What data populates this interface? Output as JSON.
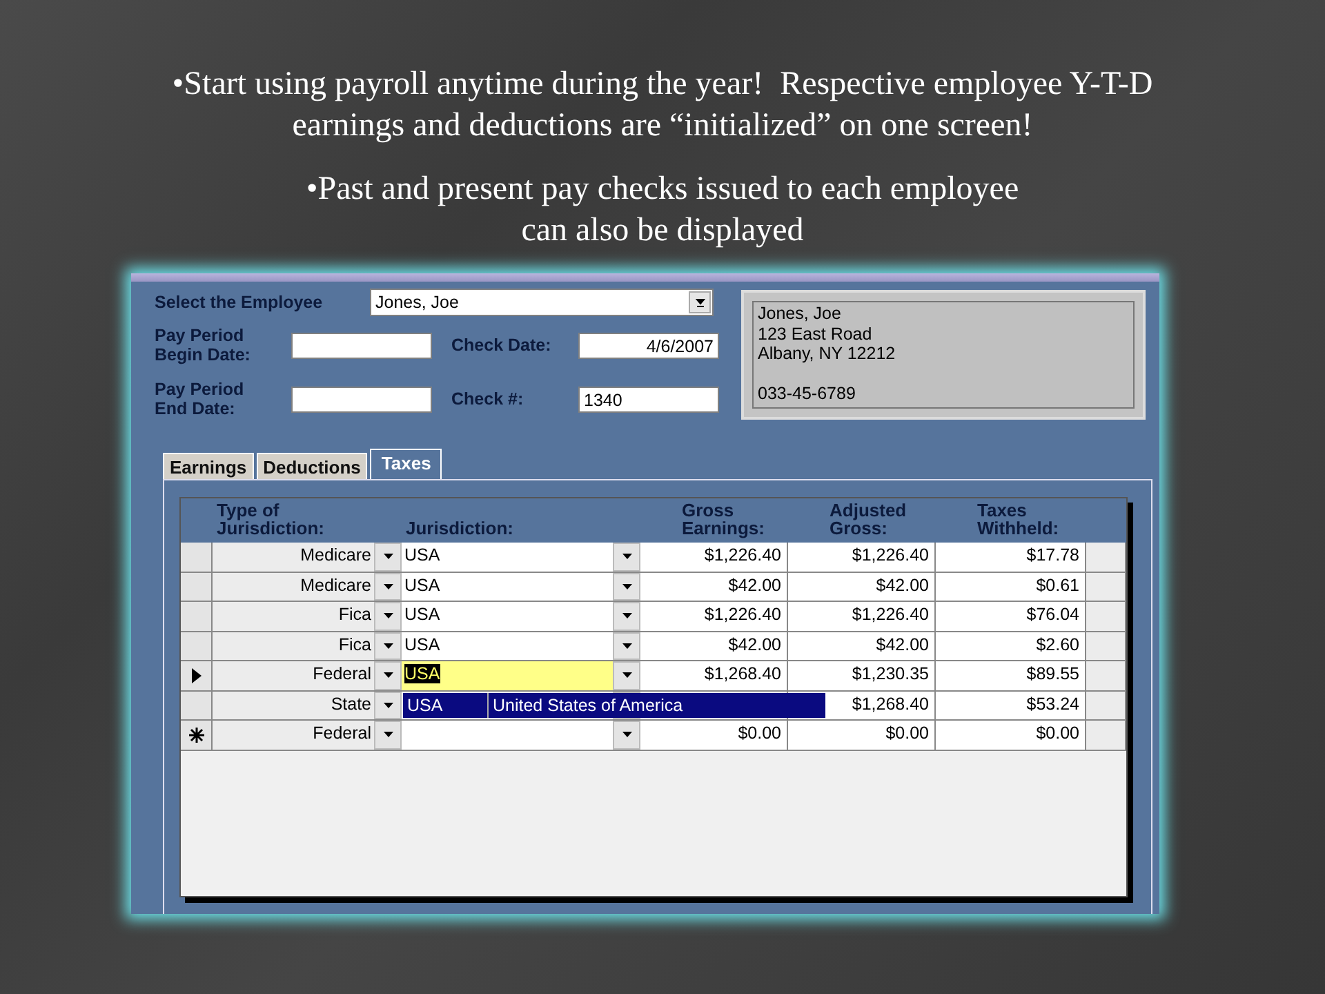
{
  "bullets": [
    "•Start using payroll anytime during the year!  Respective employee Y-T-D earnings and deductions are “initialized” on one screen!",
    "•Past and present pay checks issued to each employee can also be displayed"
  ],
  "form": {
    "employee_label": "Select the Employee",
    "employee_value": "Jones, Joe",
    "begin_label": "Pay Period\nBegin Date:",
    "check_date_label": "Check Date:",
    "check_date_value": "4/6/2007",
    "end_label": "Pay Period\nEnd Date:",
    "check_no_label": "Check #:",
    "check_no_value": "1340",
    "address": [
      "Jones, Joe",
      "123 East Road",
      "Albany, NY  12212"
    ],
    "ssn": "033-45-6789"
  },
  "tabs": [
    {
      "label": "Earnings",
      "selected": false
    },
    {
      "label": "Deductions",
      "selected": false
    },
    {
      "label": "Taxes",
      "selected": true
    }
  ],
  "table": {
    "columns": [
      "Type of\nJurisdiction:",
      "Jurisdiction:",
      "Gross\nEarnings:",
      "Adjusted\nGross:",
      "Taxes\nWithheld:"
    ],
    "rows": [
      {
        "current": false,
        "new_row": false,
        "type": "Medicare",
        "jurisdiction": "USA",
        "editing": false,
        "gross": "$1,226.40",
        "adjusted": "$1,226.40",
        "taxes": "$17.78"
      },
      {
        "current": false,
        "new_row": false,
        "type": "Medicare",
        "jurisdiction": "USA",
        "editing": false,
        "gross": "$42.00",
        "adjusted": "$42.00",
        "taxes": "$0.61"
      },
      {
        "current": false,
        "new_row": false,
        "type": "Fica",
        "jurisdiction": "USA",
        "editing": false,
        "gross": "$1,226.40",
        "adjusted": "$1,226.40",
        "taxes": "$76.04"
      },
      {
        "current": false,
        "new_row": false,
        "type": "Fica",
        "jurisdiction": "USA",
        "editing": false,
        "gross": "$42.00",
        "adjusted": "$42.00",
        "taxes": "$2.60"
      },
      {
        "current": true,
        "new_row": false,
        "type": "Federal",
        "jurisdiction": "USA",
        "editing": true,
        "gross": "$1,268.40",
        "adjusted": "$1,230.35",
        "taxes": "$89.55"
      },
      {
        "current": false,
        "new_row": false,
        "type": "State",
        "editing": false,
        "adjusted": "$1,268.40",
        "taxes": "$53.24",
        "dropdown_list": {
          "code": "USA",
          "name": "United States of America"
        }
      },
      {
        "current": false,
        "new_row": true,
        "type": "Federal",
        "editing": false,
        "gross": "$0.00",
        "adjusted": "$0.00",
        "taxes": "$0.00"
      }
    ]
  }
}
